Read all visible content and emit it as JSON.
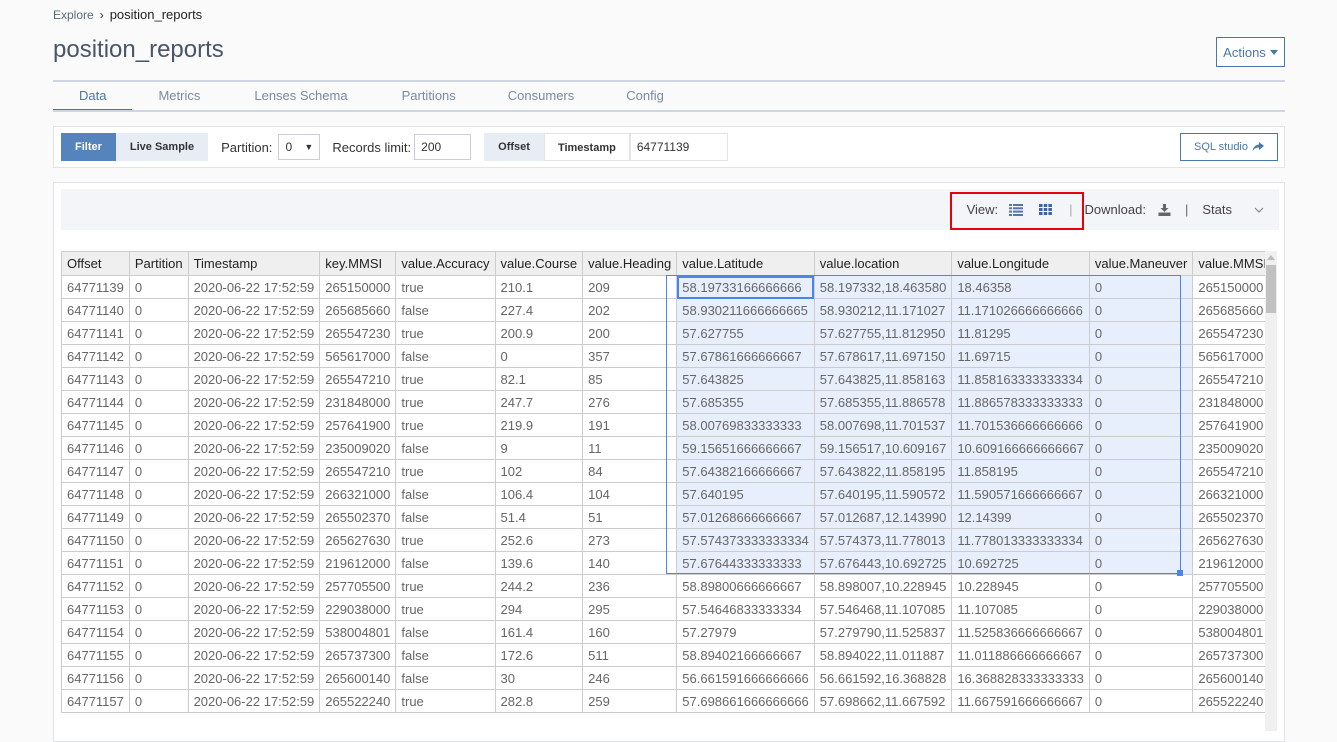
{
  "breadcrumb": {
    "root": "Explore",
    "current": "position_reports"
  },
  "page": {
    "title": "position_reports",
    "actions_label": "Actions"
  },
  "tabs": [
    {
      "label": "Data",
      "active": true
    },
    {
      "label": "Metrics",
      "active": false
    },
    {
      "label": "Lenses Schema",
      "active": false
    },
    {
      "label": "Partitions",
      "active": false
    },
    {
      "label": "Consumers",
      "active": false
    },
    {
      "label": "Config",
      "active": false
    }
  ],
  "filter_bar": {
    "mode_buttons": [
      "Filter",
      "Live Sample"
    ],
    "active_mode": "Filter",
    "partition_label": "Partition:",
    "partition_value": "0",
    "records_limit_label": "Records limit:",
    "records_limit_value": "200",
    "seek_buttons": [
      "Offset",
      "Timestamp"
    ],
    "active_seek": "Offset",
    "seek_value": "64771139",
    "sql_studio_label": "SQL studio"
  },
  "toolbar": {
    "view_label": "View:",
    "view_icons": [
      "list-view-icon",
      "grid-view-icon"
    ],
    "download_label": "Download:",
    "download_icon": "download-icon",
    "separator": "|",
    "stats_label": "Stats"
  },
  "colors": {
    "accent": "#4a77aa",
    "selection": "#e8effc",
    "highlight_box": "#e8000a"
  },
  "table": {
    "columns": [
      "Offset",
      "Partition",
      "Timestamp",
      "key.MMSI",
      "value.Accuracy",
      "value.Course",
      "value.Heading",
      "value.Latitude",
      "value.location",
      "value.Longitude",
      "value.Maneuver",
      "value.MMSI"
    ],
    "rows": [
      [
        "64771139",
        "0",
        "2020-06-22 17:52:59",
        "265150000",
        "true",
        "210.1",
        "209",
        "58.19733166666666",
        "58.197332,18.463580",
        "18.46358",
        "0",
        "265150000"
      ],
      [
        "64771140",
        "0",
        "2020-06-22 17:52:59",
        "265685660",
        "false",
        "227.4",
        "202",
        "58.930211666666665",
        "58.930212,11.171027",
        "11.171026666666666",
        "0",
        "265685660"
      ],
      [
        "64771141",
        "0",
        "2020-06-22 17:52:59",
        "265547230",
        "true",
        "200.9",
        "200",
        "57.627755",
        "57.627755,11.812950",
        "11.81295",
        "0",
        "265547230"
      ],
      [
        "64771142",
        "0",
        "2020-06-22 17:52:59",
        "565617000",
        "false",
        "0",
        "357",
        "57.67861666666667",
        "57.678617,11.697150",
        "11.69715",
        "0",
        "565617000"
      ],
      [
        "64771143",
        "0",
        "2020-06-22 17:52:59",
        "265547210",
        "true",
        "82.1",
        "85",
        "57.643825",
        "57.643825,11.858163",
        "11.858163333333334",
        "0",
        "265547210"
      ],
      [
        "64771144",
        "0",
        "2020-06-22 17:52:59",
        "231848000",
        "true",
        "247.7",
        "276",
        "57.685355",
        "57.685355,11.886578",
        "11.886578333333333",
        "0",
        "231848000"
      ],
      [
        "64771145",
        "0",
        "2020-06-22 17:52:59",
        "257641900",
        "true",
        "219.9",
        "191",
        "58.00769833333333",
        "58.007698,11.701537",
        "11.701536666666666",
        "0",
        "257641900"
      ],
      [
        "64771146",
        "0",
        "2020-06-22 17:52:59",
        "235009020",
        "false",
        "9",
        "11",
        "59.15651666666667",
        "59.156517,10.609167",
        "10.609166666666667",
        "0",
        "235009020"
      ],
      [
        "64771147",
        "0",
        "2020-06-22 17:52:59",
        "265547210",
        "true",
        "102",
        "84",
        "57.64382166666667",
        "57.643822,11.858195",
        "11.858195",
        "0",
        "265547210"
      ],
      [
        "64771148",
        "0",
        "2020-06-22 17:52:59",
        "266321000",
        "false",
        "106.4",
        "104",
        "57.640195",
        "57.640195,11.590572",
        "11.590571666666667",
        "0",
        "266321000"
      ],
      [
        "64771149",
        "0",
        "2020-06-22 17:52:59",
        "265502370",
        "false",
        "51.4",
        "51",
        "57.01268666666667",
        "57.012687,12.143990",
        "12.14399",
        "0",
        "265502370"
      ],
      [
        "64771150",
        "0",
        "2020-06-22 17:52:59",
        "265627630",
        "true",
        "252.6",
        "273",
        "57.574373333333334",
        "57.574373,11.778013",
        "11.778013333333334",
        "0",
        "265627630"
      ],
      [
        "64771151",
        "0",
        "2020-06-22 17:52:59",
        "219612000",
        "false",
        "139.6",
        "140",
        "57.67644333333333",
        "57.676443,10.692725",
        "10.692725",
        "0",
        "219612000"
      ],
      [
        "64771152",
        "0",
        "2020-06-22 17:52:59",
        "257705500",
        "true",
        "244.2",
        "236",
        "58.89800666666667",
        "58.898007,10.228945",
        "10.228945",
        "0",
        "257705500"
      ],
      [
        "64771153",
        "0",
        "2020-06-22 17:52:59",
        "229038000",
        "true",
        "294",
        "295",
        "57.54646833333334",
        "57.546468,11.107085",
        "11.107085",
        "0",
        "229038000"
      ],
      [
        "64771154",
        "0",
        "2020-06-22 17:52:59",
        "538004801",
        "false",
        "161.4",
        "160",
        "57.27979",
        "57.279790,11.525837",
        "11.525836666666667",
        "0",
        "538004801"
      ],
      [
        "64771155",
        "0",
        "2020-06-22 17:52:59",
        "265737300",
        "false",
        "172.6",
        "511",
        "58.89402166666667",
        "58.894022,11.011887",
        "11.011886666666667",
        "0",
        "265737300"
      ],
      [
        "64771156",
        "0",
        "2020-06-22 17:52:59",
        "265600140",
        "false",
        "30",
        "246",
        "56.661591666666666",
        "56.661592,16.368828",
        "16.368828333333333",
        "0",
        "265600140"
      ],
      [
        "64771157",
        "0",
        "2020-06-22 17:52:59",
        "265522240",
        "true",
        "282.8",
        "259",
        "57.698661666666666",
        "57.698662,11.667592",
        "11.667591666666667",
        "0",
        "265522240"
      ]
    ]
  }
}
